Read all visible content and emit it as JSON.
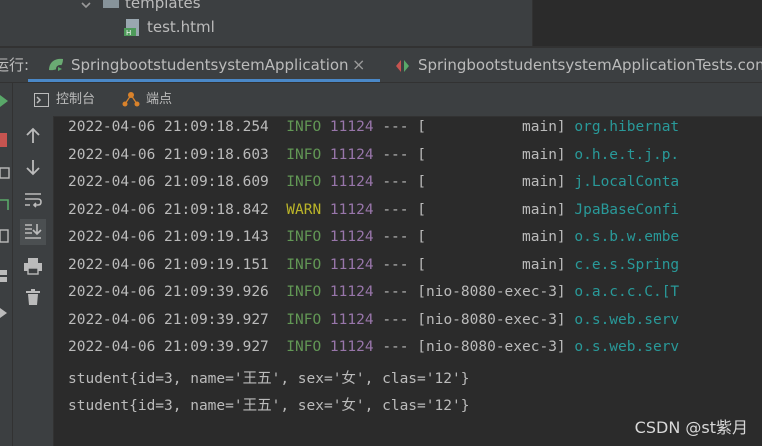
{
  "project_tree": {
    "folder_label": "templates",
    "file_label": "test.html"
  },
  "run_bar": {
    "label": "运行:",
    "tabs": [
      {
        "label": "SpringbootstudentsystemApplication",
        "close": "×"
      },
      {
        "label": "SpringbootstudentsystemApplicationTests.com"
      }
    ]
  },
  "sub_toolbar": {
    "console_label": "控制台",
    "breakpoints_label": "端点"
  },
  "console": {
    "log_lines": [
      {
        "timestamp": "2022-04-06 21:09:18.254",
        "level": "INFO",
        "pid": "11124",
        "sep": "---",
        "thread": "[           main]",
        "logger": "org.hibernat"
      },
      {
        "timestamp": "2022-04-06 21:09:18.603",
        "level": "INFO",
        "pid": "11124",
        "sep": "---",
        "thread": "[           main]",
        "logger": "o.h.e.t.j.p."
      },
      {
        "timestamp": "2022-04-06 21:09:18.609",
        "level": "INFO",
        "pid": "11124",
        "sep": "---",
        "thread": "[           main]",
        "logger": "j.LocalConta"
      },
      {
        "timestamp": "2022-04-06 21:09:18.842",
        "level": "WARN",
        "pid": "11124",
        "sep": "---",
        "thread": "[           main]",
        "logger": "JpaBaseConfi"
      },
      {
        "timestamp": "2022-04-06 21:09:19.143",
        "level": "INFO",
        "pid": "11124",
        "sep": "---",
        "thread": "[           main]",
        "logger": "o.s.b.w.embe"
      },
      {
        "timestamp": "2022-04-06 21:09:19.151",
        "level": "INFO",
        "pid": "11124",
        "sep": "---",
        "thread": "[           main]",
        "logger": "c.e.s.Spring"
      },
      {
        "timestamp": "2022-04-06 21:09:39.926",
        "level": "INFO",
        "pid": "11124",
        "sep": "---",
        "thread": "[nio-8080-exec-3]",
        "logger": "o.a.c.c.C.[T"
      },
      {
        "timestamp": "2022-04-06 21:09:39.927",
        "level": "INFO",
        "pid": "11124",
        "sep": "---",
        "thread": "[nio-8080-exec-3]",
        "logger": "o.s.web.serv"
      },
      {
        "timestamp": "2022-04-06 21:09:39.927",
        "level": "INFO",
        "pid": "11124",
        "sep": "---",
        "thread": "[nio-8080-exec-3]",
        "logger": "o.s.web.serv"
      }
    ],
    "output_lines": [
      "student{id=3, name='王五', sex='女', clas='12'}",
      "student{id=3, name='王五', sex='女', clas='12'}"
    ]
  },
  "left_tools": [
    "arrow-up-icon",
    "arrow-down-icon",
    "soft-wrap-icon",
    "scroll-to-end-icon",
    "print-icon",
    "trash-icon"
  ],
  "watermark": "CSDN @st紫月",
  "colors": {
    "info": "#629755",
    "warn": "#bbb529",
    "pid": "#9876aa",
    "logger": "#299999",
    "text": "#bbbbbb",
    "background": "#2b2b2b"
  }
}
